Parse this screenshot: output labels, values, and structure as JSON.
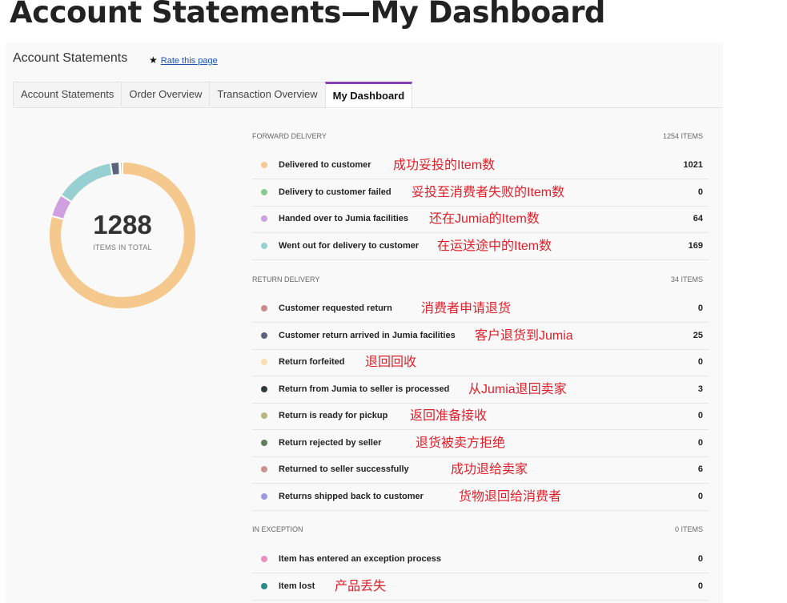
{
  "page_title": "Account Statements—My Dashboard",
  "header": {
    "title": "Account Statements",
    "rate_link": "Rate this page"
  },
  "tabs": [
    {
      "label": "Account Statements"
    },
    {
      "label": "Order Overview"
    },
    {
      "label": "Transaction Overview"
    },
    {
      "label": "My Dashboard",
      "active": true
    }
  ],
  "summary": {
    "total": "1288",
    "total_label": "ITEMS IN TOTAL"
  },
  "donut": [
    {
      "value": 1021,
      "color": "#f5c98e"
    },
    {
      "value": 0,
      "color": "#8dc98f"
    },
    {
      "value": 64,
      "color": "#cf9fe0"
    },
    {
      "value": 169,
      "color": "#97d0d2"
    },
    {
      "value": 25,
      "color": "#5a637a"
    },
    {
      "value": 3,
      "color": "#2f3a3a"
    },
    {
      "value": 6,
      "color": "#c9958a"
    }
  ],
  "sections": [
    {
      "name": "FORWARD DELIVERY",
      "count": "1254 ITEMS",
      "rows": [
        {
          "label": "Delivered to customer",
          "value": "1021",
          "color": "#f5c98e",
          "note": "成功妥投的Item数"
        },
        {
          "label": "Delivery to customer failed",
          "value": "0",
          "color": "#8dc98f",
          "note": "妥投至消费者失败的Item数"
        },
        {
          "label": "Handed over to Jumia facilities",
          "value": "64",
          "color": "#cf9fe0",
          "note": "还在Jumia的Item数"
        },
        {
          "label": "Went out for delivery to customer",
          "value": "169",
          "color": "#97d0d2",
          "note": "在运送途中的Item数"
        }
      ]
    },
    {
      "name": "RETURN DELIVERY",
      "count": "34 ITEMS",
      "rows": [
        {
          "label": "Customer requested return",
          "value": "0",
          "color": "#cc8b8b",
          "note": "消费者申请退货"
        },
        {
          "label": "Customer return arrived in Jumia facilities",
          "value": "25",
          "color": "#5a637a",
          "note": "客户退货到Jumia"
        },
        {
          "label": "Return forfeited",
          "value": "0",
          "color": "#fbdfb0",
          "note": "退回回收"
        },
        {
          "label": "Return from Jumia to seller is processed",
          "value": "3",
          "color": "#2f3a3a",
          "note": "从Jumia退回卖家"
        },
        {
          "label": "Return is ready for pickup",
          "value": "0",
          "color": "#b8b67a",
          "note": "返回准备接收"
        },
        {
          "label": "Return rejected by seller",
          "value": "0",
          "color": "#5f7f5b",
          "note": "退货被卖方拒绝"
        },
        {
          "label": "Returned to seller successfully",
          "value": "6",
          "color": "#c9958a",
          "note": "成功退给卖家"
        },
        {
          "label": "Returns shipped back to customer",
          "value": "0",
          "color": "#9a9ade",
          "note": "货物退回给消费者"
        }
      ]
    },
    {
      "name": "IN EXCEPTION",
      "count": "0 ITEMS",
      "rows": [
        {
          "label": "Item has entered an exception process",
          "value": "0",
          "color": "#ea8fc0",
          "note": ""
        },
        {
          "label": "Item lost",
          "value": "0",
          "color": "#2a8a8a",
          "note": "产品丢失"
        }
      ]
    }
  ]
}
